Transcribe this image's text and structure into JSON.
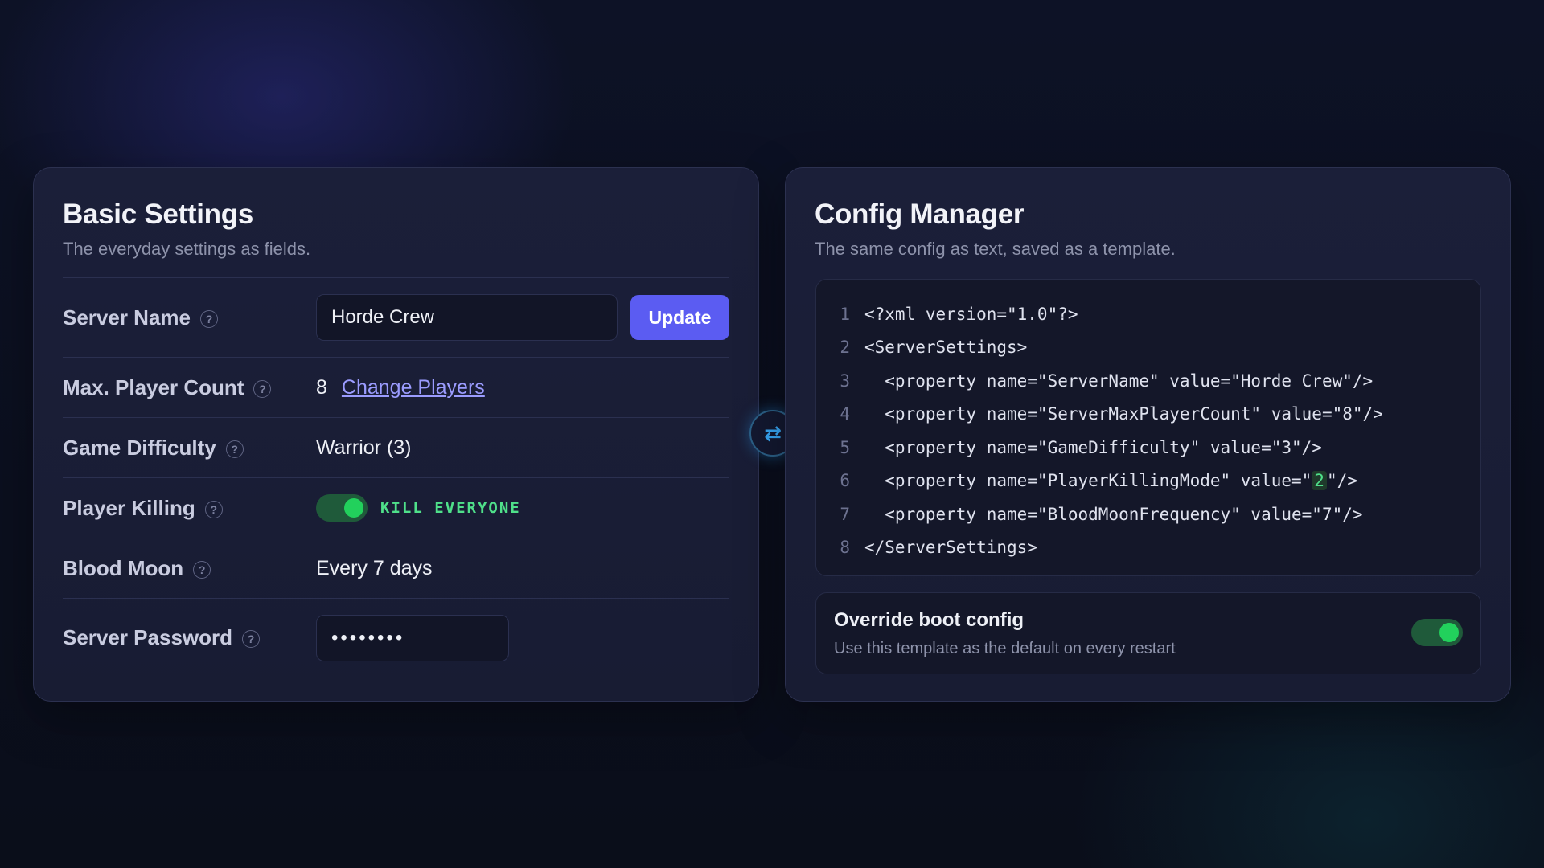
{
  "basic_settings": {
    "title": "Basic Settings",
    "subtitle": "The everyday settings as fields.",
    "server_name": {
      "label": "Server Name",
      "help": "?",
      "value": "Horde Crew",
      "button": "Update"
    },
    "max_player_count": {
      "label": "Max. Player Count",
      "help": "?",
      "value": "8",
      "link": "Change Players"
    },
    "game_difficulty": {
      "label": "Game Difficulty",
      "help": "?",
      "value": "Warrior (3)"
    },
    "player_killing": {
      "label": "Player Killing",
      "help": "?",
      "toggle_on": true,
      "badge": "KILL EVERYONE"
    },
    "blood_moon": {
      "label": "Blood Moon",
      "help": "?",
      "value": "Every 7 days"
    },
    "server_password": {
      "label": "Server Password",
      "help": "?",
      "value": "••••••••"
    }
  },
  "swap": {
    "icon": "swap-arrows-icon",
    "glyph": "⇄"
  },
  "config_manager": {
    "title": "Config Manager",
    "subtitle": "The same config as text, saved as a template.",
    "code_lines": [
      {
        "n": "1",
        "pre": "<?xml version=\"1.0\"?>",
        "hl": "",
        "post": ""
      },
      {
        "n": "2",
        "pre": "<ServerSettings>",
        "hl": "",
        "post": ""
      },
      {
        "n": "3",
        "pre": "  <property name=\"ServerName\" value=\"Horde Crew\"/>",
        "hl": "",
        "post": ""
      },
      {
        "n": "4",
        "pre": "  <property name=\"ServerMaxPlayerCount\" value=\"8\"/>",
        "hl": "",
        "post": ""
      },
      {
        "n": "5",
        "pre": "  <property name=\"GameDifficulty\" value=\"3\"/>",
        "hl": "",
        "post": ""
      },
      {
        "n": "6",
        "pre": "  <property name=\"PlayerKillingMode\" value=\"",
        "hl": "2",
        "post": "\"/>"
      },
      {
        "n": "7",
        "pre": "  <property name=\"BloodMoonFrequency\" value=\"7\"/>",
        "hl": "",
        "post": ""
      },
      {
        "n": "8",
        "pre": "</ServerSettings>",
        "hl": "",
        "post": ""
      }
    ],
    "override": {
      "title": "Override boot config",
      "subtitle": "Use this template as the default on every restart",
      "toggle_on": true
    }
  },
  "colors": {
    "accent": "#5b5cf2",
    "toggle_on": "#22d15c",
    "badge_green": "#4fe08a",
    "link": "#9b9cff"
  }
}
